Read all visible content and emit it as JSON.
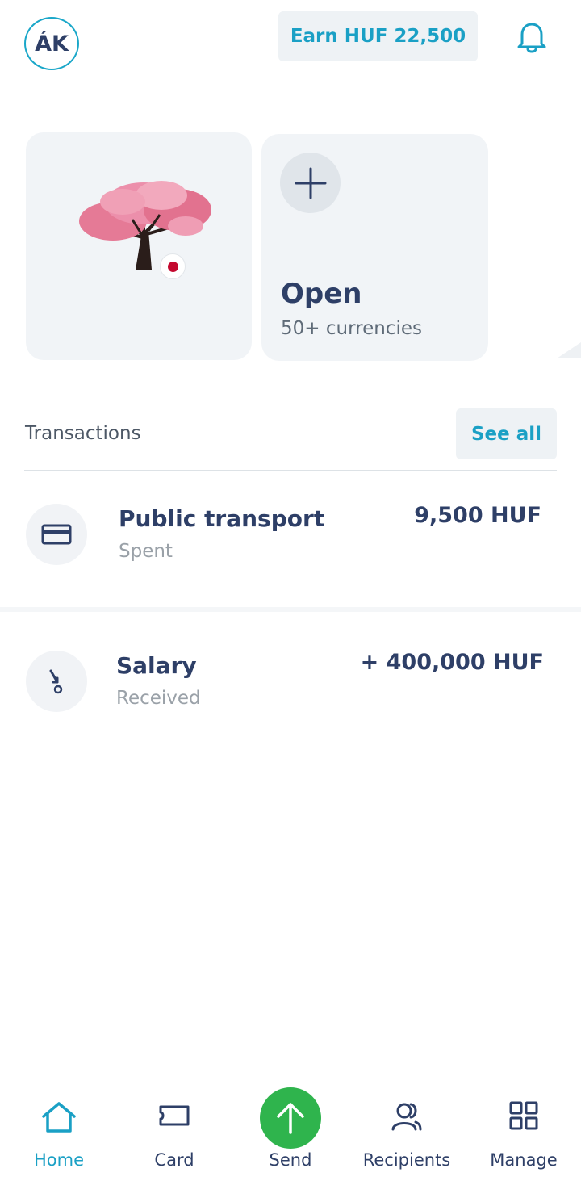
{
  "header": {
    "avatar_initials": "ÁK",
    "earn_label": "Earn HUF 22,500",
    "bell_icon": "bell-icon"
  },
  "balances": {
    "currency_tile": {
      "flag": "japan-flag",
      "illustration": "cherry-blossom-tree"
    },
    "open_tile": {
      "title": "Open",
      "subtitle": "50+ currencies",
      "icon": "plus-icon"
    }
  },
  "transactions": {
    "heading": "Transactions",
    "see_all_label": "See all",
    "items": [
      {
        "title": "Public transport",
        "status": "Spent",
        "amount": "9,500 HUF",
        "icon": "card-icon"
      },
      {
        "title": "Salary",
        "status": "Received",
        "amount": "+ 400,000 HUF",
        "icon": "incoming-arrow-icon"
      }
    ]
  },
  "nav": {
    "items": [
      {
        "label": "Home",
        "icon": "home-icon",
        "active": true
      },
      {
        "label": "Card",
        "icon": "card-icon"
      },
      {
        "label": "Send",
        "icon": "arrow-up-icon"
      },
      {
        "label": "Recipients",
        "icon": "people-icon"
      },
      {
        "label": "Manage",
        "icon": "grid-icon"
      }
    ]
  },
  "colors": {
    "accent": "#1aa0c5",
    "primary_text": "#2e3f67",
    "send_green": "#2fb44d",
    "tile_bg": "#f1f4f7"
  }
}
